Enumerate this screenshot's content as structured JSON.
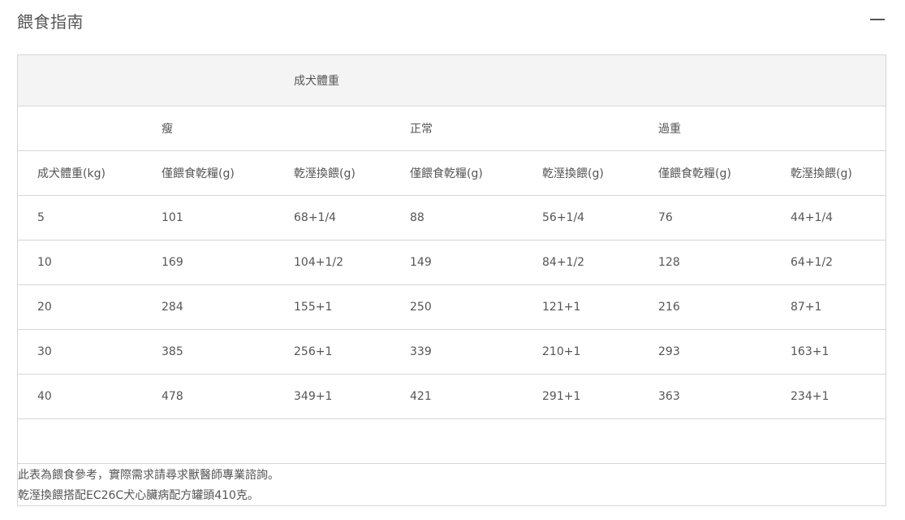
{
  "section": {
    "title": "餵食指南",
    "collapse_icon": "minus-icon"
  },
  "table": {
    "group_header": "成犬體重",
    "conditions": [
      "瘦",
      "正常",
      "過重"
    ],
    "columns": [
      "成犬體重(kg)",
      "僅餵食乾糧(g)",
      "乾溼換餵(g)",
      "僅餵食乾糧(g)",
      "乾溼換餵(g)",
      "僅餵食乾糧(g)",
      "乾溼換餵(g)"
    ],
    "rows": [
      [
        "5",
        "101",
        "68+1/4",
        "88",
        "56+1/4",
        "76",
        "44+1/4"
      ],
      [
        "10",
        "169",
        "104+1/2",
        "149",
        "84+1/2",
        "128",
        "64+1/2"
      ],
      [
        "20",
        "284",
        "155+1",
        "250",
        "121+1",
        "216",
        "87+1"
      ],
      [
        "30",
        "385",
        "256+1",
        "339",
        "210+1",
        "293",
        "163+1"
      ],
      [
        "40",
        "478",
        "349+1",
        "421",
        "291+1",
        "363",
        "234+1"
      ]
    ],
    "notes": [
      "此表為餵食參考，實際需求請尋求獸醫師專業諮詢。",
      "乾溼換餵搭配EC26C犬心臟病配方罐頭410克。"
    ]
  }
}
